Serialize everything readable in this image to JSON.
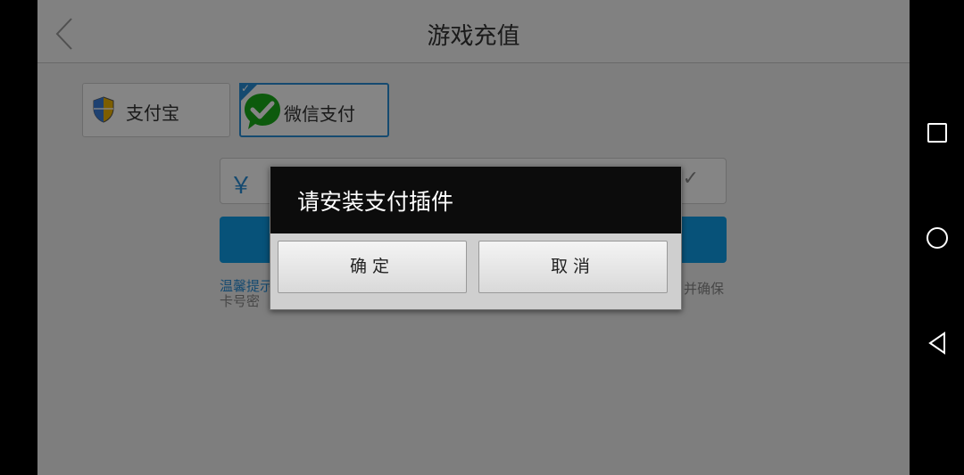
{
  "header": {
    "title": "游戏充值"
  },
  "payment_options": [
    {
      "label": "支付宝",
      "selected": false,
      "icon": "shield-icon"
    },
    {
      "label": "微信支付",
      "selected": true,
      "icon": "wechat-check-icon"
    }
  ],
  "amount_field": {
    "currency_symbol": "￥",
    "check": "✓"
  },
  "tips": {
    "label": "温馨提示",
    "line1_tail": "并确保",
    "line2_start": "卡号密"
  },
  "dialog": {
    "title": "请安装支付插件",
    "confirm_label": "确定",
    "cancel_label": "取消"
  },
  "colors": {
    "accent": "#2a8fd6",
    "button_blue": "#0f9ee8",
    "wechat_green": "#1aad19"
  }
}
